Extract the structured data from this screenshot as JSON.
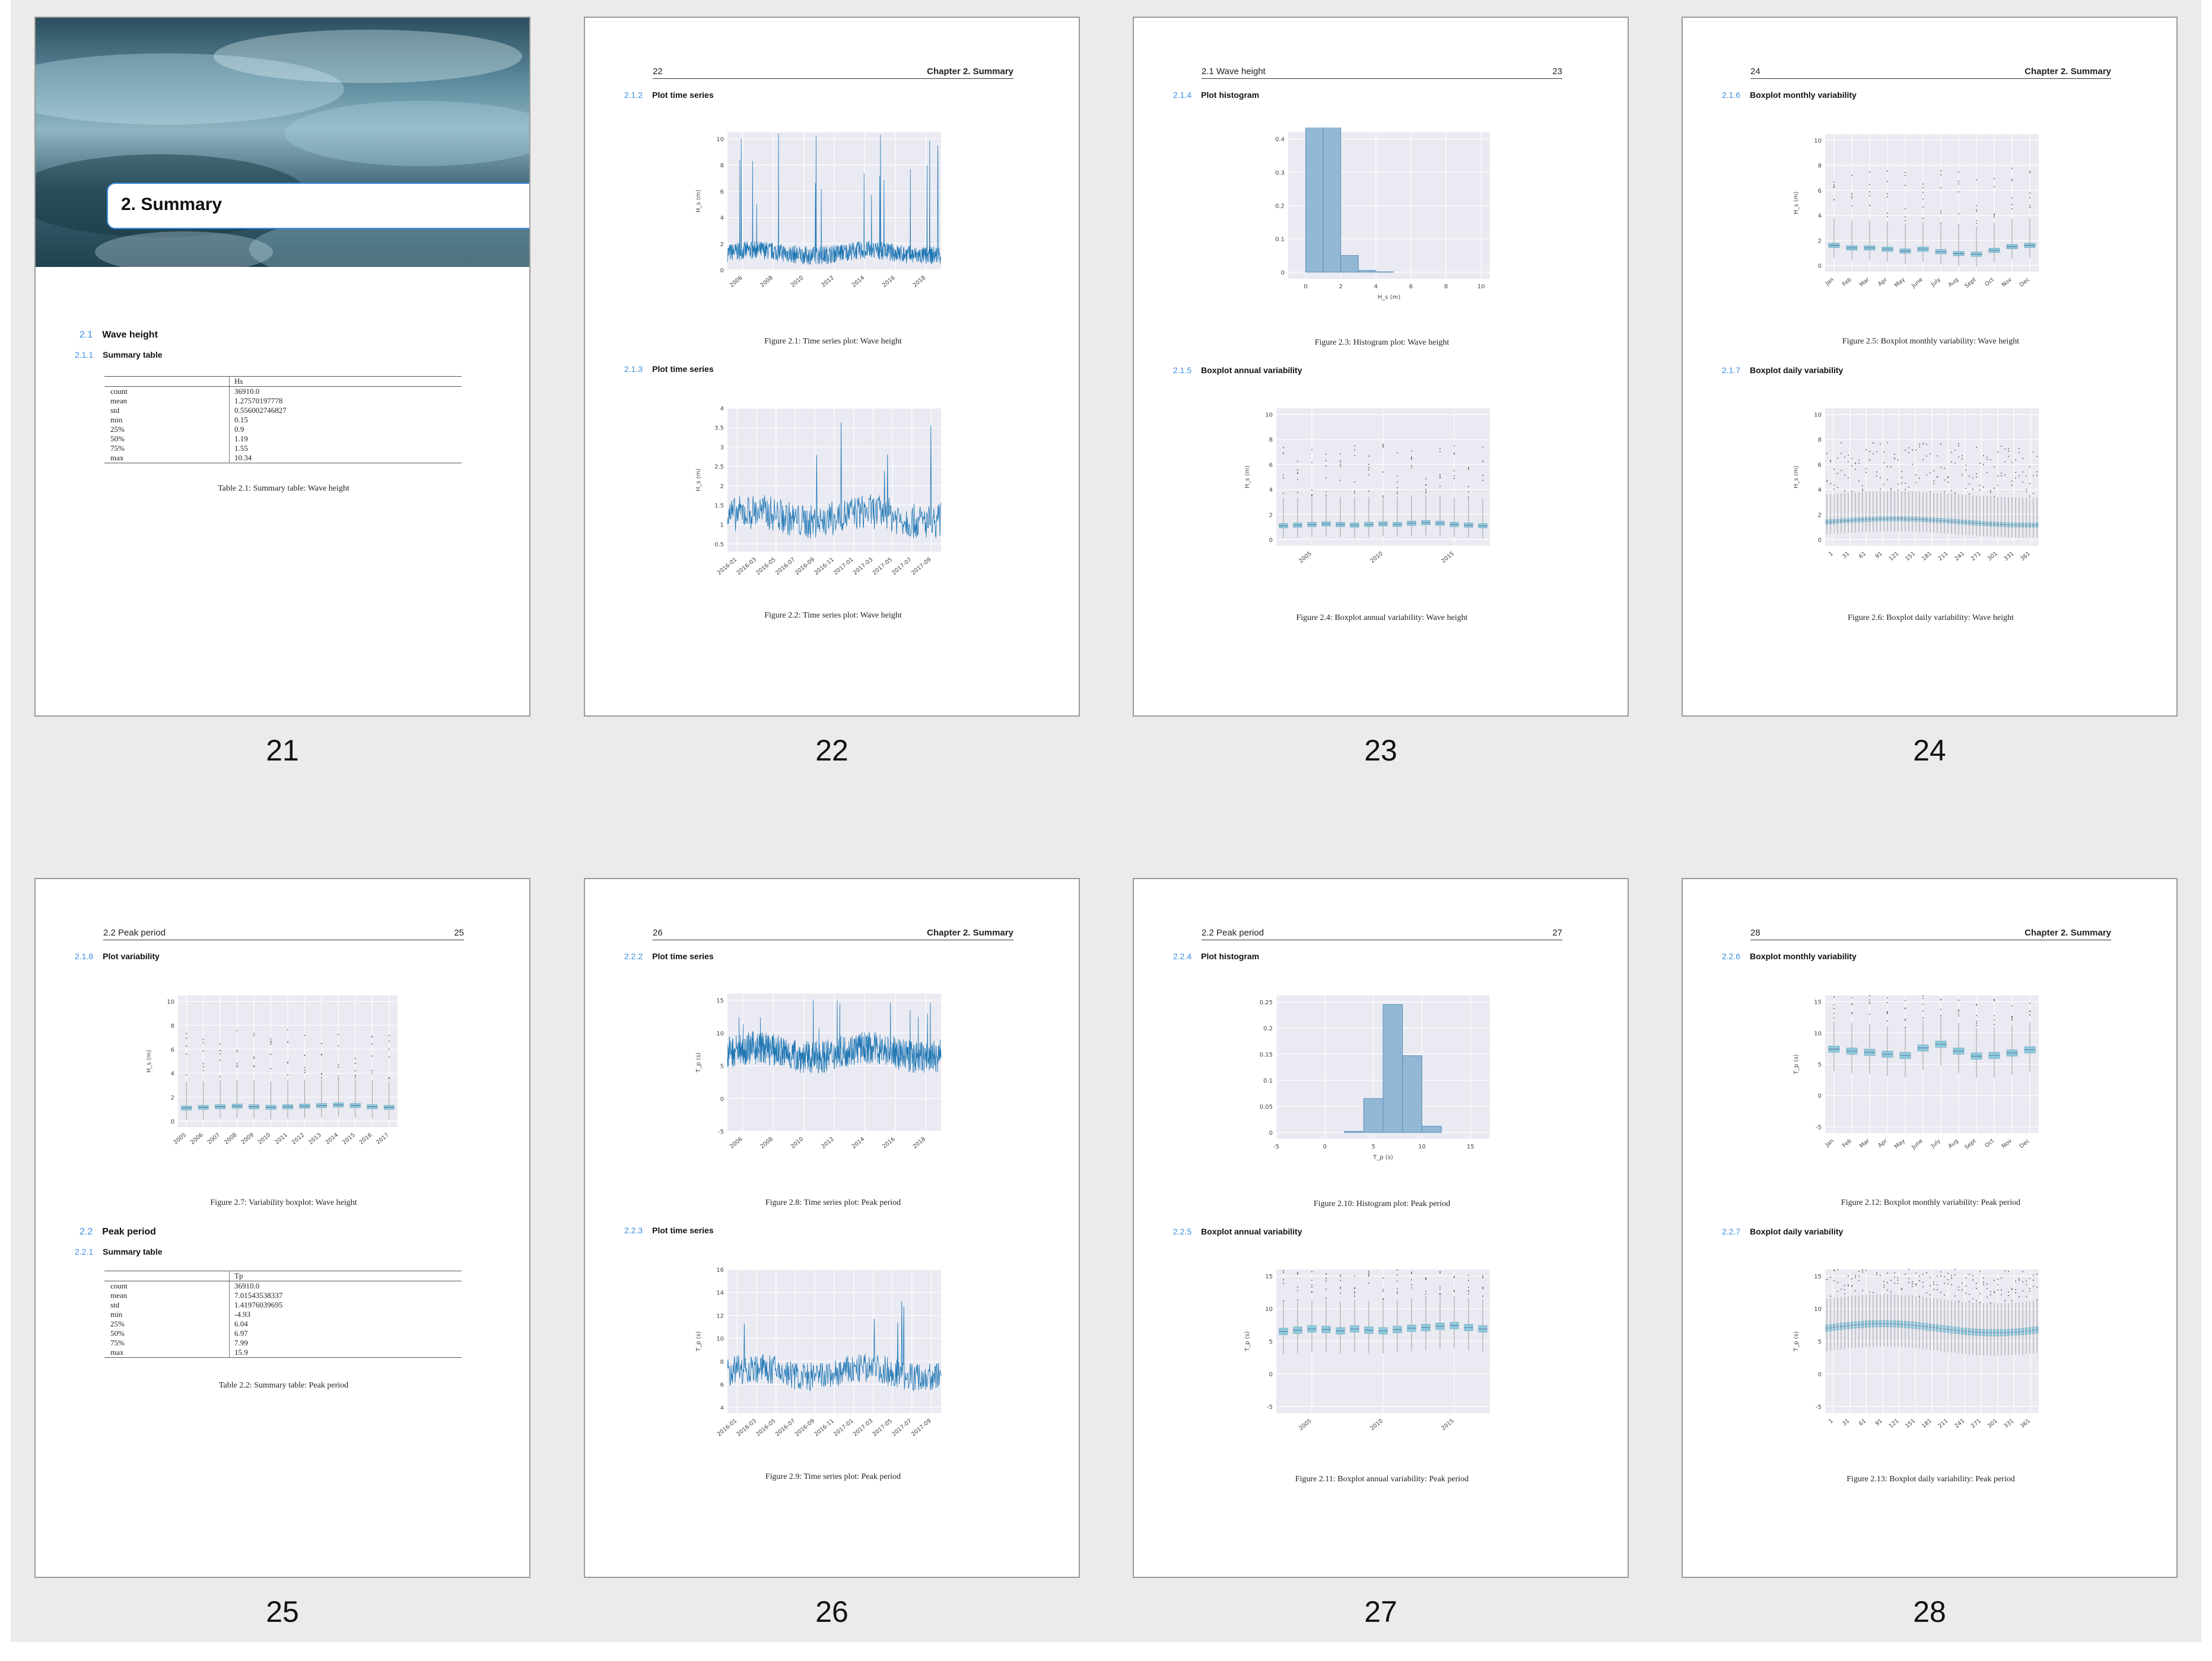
{
  "pages": [
    {
      "number": "21"
    },
    {
      "number": "22",
      "header_left": "22",
      "header_right": "Chapter 2. Summary"
    },
    {
      "number": "23",
      "header_left": "2.1 Wave height",
      "header_right": "23"
    },
    {
      "number": "24",
      "header_left": "24",
      "header_right": "Chapter 2. Summary"
    },
    {
      "number": "25",
      "header_left": "2.2 Peak period",
      "header_right": "25"
    },
    {
      "number": "26",
      "header_left": "26",
      "header_right": "Chapter 2. Summary"
    },
    {
      "number": "27",
      "header_left": "2.2 Peak period",
      "header_right": "27"
    },
    {
      "number": "28",
      "header_left": "28",
      "header_right": "Chapter 2. Summary"
    }
  ],
  "chapter_title": "2. Summary",
  "sections": {
    "s2_1": {
      "num": "2.1",
      "title": "Wave height"
    },
    "s2_1_1": {
      "num": "2.1.1",
      "title": "Summary table"
    },
    "s2_1_2": {
      "num": "2.1.2",
      "title": "Plot time series"
    },
    "s2_1_3": {
      "num": "2.1.3",
      "title": "Plot time series"
    },
    "s2_1_4": {
      "num": "2.1.4",
      "title": "Plot histogram"
    },
    "s2_1_5": {
      "num": "2.1.5",
      "title": "Boxplot annual variability"
    },
    "s2_1_6": {
      "num": "2.1.6",
      "title": "Boxplot monthly variability"
    },
    "s2_1_7": {
      "num": "2.1.7",
      "title": "Boxplot daily variability"
    },
    "s2_1_8": {
      "num": "2.1.8",
      "title": "Plot variability"
    },
    "s2_2": {
      "num": "2.2",
      "title": "Peak period"
    },
    "s2_2_1": {
      "num": "2.2.1",
      "title": "Summary table"
    },
    "s2_2_2": {
      "num": "2.2.2",
      "title": "Plot time series"
    },
    "s2_2_3": {
      "num": "2.2.3",
      "title": "Plot time series"
    },
    "s2_2_4": {
      "num": "2.2.4",
      "title": "Plot histogram"
    },
    "s2_2_5": {
      "num": "2.2.5",
      "title": "Boxplot annual variability"
    },
    "s2_2_6": {
      "num": "2.2.6",
      "title": "Boxplot monthly variability"
    },
    "s2_2_7": {
      "num": "2.2.7",
      "title": "Boxplot daily variability"
    }
  },
  "tables": {
    "hs": {
      "column": "Hs",
      "caption": "Table 2.1: Summary table: Wave height",
      "rows": [
        [
          "count",
          "36910.0"
        ],
        [
          "mean",
          "1.27570197778"
        ],
        [
          "std",
          "0.556002746827"
        ],
        [
          "min",
          "0.15"
        ],
        [
          "25%",
          "0.9"
        ],
        [
          "50%",
          "1.19"
        ],
        [
          "75%",
          "1.55"
        ],
        [
          "max",
          "10.34"
        ]
      ]
    },
    "tp": {
      "column": "Tp",
      "caption": "Table 2.2: Summary table: Peak period",
      "rows": [
        [
          "count",
          "36910.0"
        ],
        [
          "mean",
          "7.01543538337"
        ],
        [
          "std",
          "1.41976039695"
        ],
        [
          "min",
          "-4.93"
        ],
        [
          "25%",
          "6.04"
        ],
        [
          "50%",
          "6.97"
        ],
        [
          "75%",
          "7.99"
        ],
        [
          "max",
          "15.9"
        ]
      ]
    }
  },
  "figures": {
    "f2_1": {
      "caption": "Figure 2.1: Time series plot: Wave height"
    },
    "f2_2": {
      "caption": "Figure 2.2: Time series plot: Wave height"
    },
    "f2_3": {
      "caption": "Figure 2.3: Histogram plot: Wave height"
    },
    "f2_4": {
      "caption": "Figure 2.4: Boxplot annual variability: Wave height"
    },
    "f2_5": {
      "caption": "Figure 2.5: Boxplot monthly variability: Wave height"
    },
    "f2_6": {
      "caption": "Figure 2.6: Boxplot daily variability: Wave height"
    },
    "f2_7": {
      "caption": "Figure 2.7: Variability boxplot: Wave height"
    },
    "f2_8": {
      "caption": "Figure 2.8: Time series plot: Peak period"
    },
    "f2_9": {
      "caption": "Figure 2.9: Time series plot: Peak period"
    },
    "f2_10": {
      "caption": "Figure 2.10: Histogram plot: Peak period"
    },
    "f2_11": {
      "caption": "Figure 2.11: Boxplot annual variability: Peak period"
    },
    "f2_12": {
      "caption": "Figure 2.12: Boxplot monthly variability: Peak period"
    },
    "f2_13": {
      "caption": "Figure 2.13: Boxplot daily variability: Peak period"
    }
  },
  "colors": {
    "accent": "#3c8ee0",
    "line": "#1f77b4",
    "box": "#8ccbe0",
    "plot_bg": "#eaeaf2",
    "hist": "#92b8d6"
  },
  "chart_data": [
    {
      "id": "f2_1",
      "type": "line",
      "ylabel": "H_s (m)",
      "yticks": [
        0,
        2,
        4,
        6,
        8,
        10
      ],
      "ylim": [
        0,
        10.5
      ],
      "xticks": [
        "2006",
        "2008",
        "2010",
        "2012",
        "2014",
        "2016",
        "2018"
      ],
      "series": [
        {
          "values": "dense time series, baseline ~1.3 m, peaks up to ~10.3 m"
        }
      ]
    },
    {
      "id": "f2_2",
      "type": "line",
      "ylabel": "H_s (m)",
      "yticks": [
        0.5,
        1.0,
        1.5,
        2.0,
        2.5,
        3.0,
        3.5,
        4.0
      ],
      "ylim": [
        0.3,
        4.0
      ],
      "xticks": [
        "2016-01",
        "2016-03",
        "2016-05",
        "2016-07",
        "2016-09",
        "2016-11",
        "2017-01",
        "2017-03",
        "2017-05",
        "2017-07",
        "2017-09"
      ]
    },
    {
      "id": "f2_3",
      "type": "bar",
      "xlabel": "H_s (m)",
      "yticks": [
        0.0,
        0.1,
        0.2,
        0.3,
        0.4
      ],
      "xticks": [
        0,
        2,
        4,
        6,
        8,
        10
      ],
      "bins": [
        [
          0,
          1,
          0.465
        ],
        [
          1,
          2,
          0.46
        ],
        [
          2,
          3,
          0.05
        ],
        [
          3,
          4,
          0.005
        ],
        [
          4,
          5,
          0.001
        ]
      ]
    },
    {
      "id": "f2_4",
      "type": "box",
      "ylabel": "H_s (m)",
      "yticks": [
        0,
        2,
        4,
        6,
        8,
        10
      ],
      "xticks": [
        "2005",
        "2010",
        "2015"
      ],
      "boxes": [
        1.1,
        1.15,
        1.2,
        1.25,
        1.2,
        1.15,
        1.2,
        1.25,
        1.2,
        1.3,
        1.35,
        1.3,
        1.2,
        1.15,
        1.1
      ]
    },
    {
      "id": "f2_5",
      "type": "box",
      "ylabel": "H_s (m)",
      "yticks": [
        0,
        2,
        4,
        6,
        8,
        10
      ],
      "xticks": [
        "Jan",
        "Feb",
        "Mar",
        "Apr",
        "May",
        "June",
        "July",
        "Aug",
        "Sept",
        "Oct",
        "Nov",
        "Dec"
      ],
      "boxes": [
        1.6,
        1.4,
        1.4,
        1.3,
        1.15,
        1.3,
        1.1,
        0.95,
        0.9,
        1.2,
        1.5,
        1.6
      ]
    },
    {
      "id": "f2_6",
      "type": "box",
      "ylabel": "H_s (m)",
      "yticks": [
        0,
        2,
        4,
        6,
        8,
        10
      ],
      "xticks": [
        "1",
        "31",
        "61",
        "91",
        "121",
        "151",
        "181",
        "211",
        "241",
        "271",
        "301",
        "331",
        "361"
      ]
    },
    {
      "id": "f2_7",
      "type": "box",
      "ylabel": "H_s (m)",
      "yticks": [
        0,
        2,
        4,
        6,
        8,
        10
      ],
      "xticks": [
        "2005",
        "2006",
        "2007",
        "2008",
        "2009",
        "2010",
        "2011",
        "2012",
        "2013",
        "2014",
        "2015",
        "2016",
        "2017"
      ],
      "boxes": [
        1.1,
        1.15,
        1.2,
        1.25,
        1.2,
        1.15,
        1.2,
        1.25,
        1.3,
        1.35,
        1.3,
        1.2,
        1.15
      ]
    },
    {
      "id": "f2_8",
      "type": "line",
      "ylabel": "T_p (s)",
      "yticks": [
        -5,
        0,
        5,
        10,
        15
      ],
      "ylim": [
        -5,
        16
      ],
      "xticks": [
        "2006",
        "2008",
        "2010",
        "2012",
        "2014",
        "2016",
        "2018"
      ]
    },
    {
      "id": "f2_9",
      "type": "line",
      "ylabel": "T_p (s)",
      "yticks": [
        4,
        6,
        8,
        10,
        12,
        14,
        16
      ],
      "ylim": [
        3.5,
        16
      ],
      "xticks": [
        "2016-01",
        "2016-03",
        "2016-05",
        "2016-07",
        "2016-09",
        "2016-11",
        "2017-01",
        "2017-03",
        "2017-05",
        "2017-07",
        "2017-09"
      ]
    },
    {
      "id": "f2_10",
      "type": "bar",
      "xlabel": "T_p (s)",
      "yticks": [
        0.0,
        0.05,
        0.1,
        0.15,
        0.2,
        0.25
      ],
      "xticks": [
        -5,
        0,
        5,
        10,
        15
      ],
      "bins": [
        [
          2,
          4,
          0.002
        ],
        [
          4,
          6,
          0.065
        ],
        [
          6,
          8,
          0.245
        ],
        [
          8,
          10,
          0.147
        ],
        [
          10,
          12,
          0.012
        ]
      ]
    },
    {
      "id": "f2_11",
      "type": "box",
      "ylabel": "T_p (s)",
      "yticks": [
        -5,
        0,
        5,
        10,
        15
      ],
      "xticks": [
        "2005",
        "2010",
        "2015"
      ],
      "boxes": [
        6.5,
        6.7,
        6.9,
        6.8,
        6.6,
        6.9,
        6.7,
        6.6,
        6.8,
        7.0,
        7.1,
        7.3,
        7.4,
        7.1,
        6.9
      ]
    },
    {
      "id": "f2_12",
      "type": "box",
      "ylabel": "T_p (s)",
      "yticks": [
        -5,
        0,
        5,
        10,
        15
      ],
      "xticks": [
        "Jan",
        "Feb",
        "Mar",
        "Apr",
        "May",
        "June",
        "July",
        "Aug",
        "Sept",
        "Oct",
        "Nov",
        "Dec"
      ],
      "boxes": [
        7.4,
        7.1,
        6.9,
        6.6,
        6.4,
        7.6,
        8.2,
        7.1,
        6.3,
        6.4,
        6.8,
        7.3
      ]
    },
    {
      "id": "f2_13",
      "type": "box",
      "ylabel": "T_p (s)",
      "yticks": [
        -5,
        0,
        5,
        10,
        15
      ],
      "xticks": [
        "1",
        "31",
        "61",
        "91",
        "121",
        "151",
        "181",
        "211",
        "241",
        "271",
        "301",
        "331",
        "361"
      ]
    }
  ]
}
